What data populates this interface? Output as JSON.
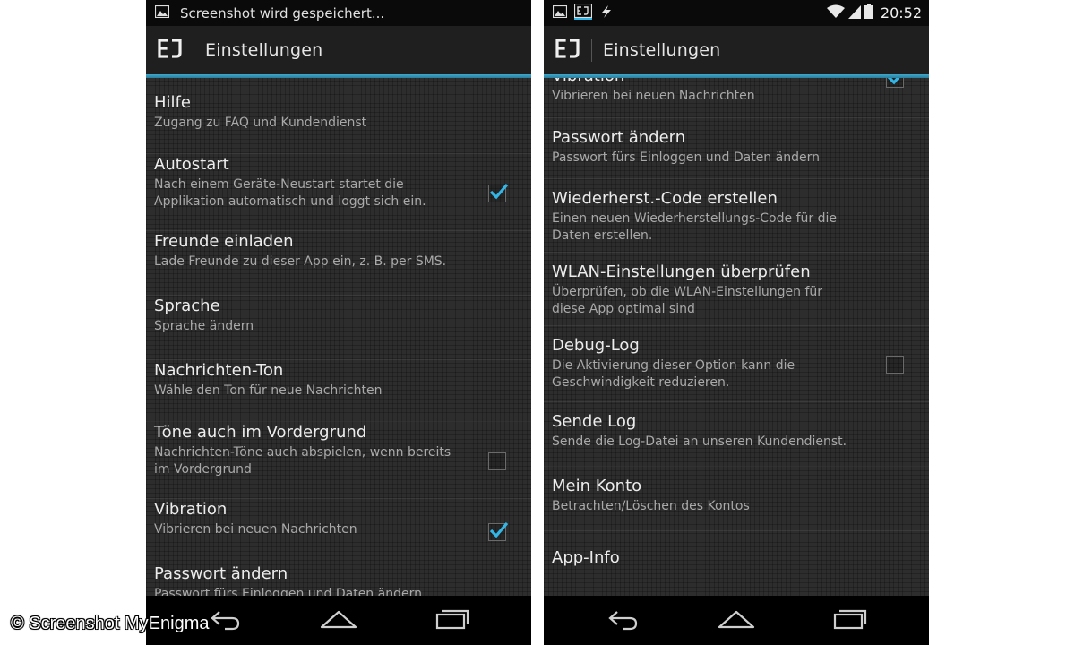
{
  "left_screen": {
    "status_text": "Screenshot wird gespeichert...",
    "title": "Einstellungen",
    "items": [
      {
        "title": "Hilfe",
        "summary": "Zugang zu FAQ und Kundendienst"
      },
      {
        "title": "Autostart",
        "summary": "Nach einem Geräte-Neustart startet die Applikation automatisch und loggt sich ein.",
        "checked": true
      },
      {
        "title": "Freunde einladen",
        "summary": "Lade Freunde zu dieser App ein, z. B. per SMS."
      },
      {
        "title": "Sprache",
        "summary": "Sprache ändern"
      },
      {
        "title": "Nachrichten-Ton",
        "summary": "Wähle den Ton für neue Nachrichten"
      },
      {
        "title": "Töne auch im Vordergrund",
        "summary": "Nachrichten-Töne auch abspielen, wenn bereits im Vordergrund",
        "checked": false
      },
      {
        "title": "Vibration",
        "summary": "Vibrieren bei neuen Nachrichten",
        "checked": true
      },
      {
        "title": "Passwort ändern",
        "summary": "Passwort fürs Einloggen und Daten ändern"
      }
    ]
  },
  "right_screen": {
    "time": "20:52",
    "title": "Einstellungen",
    "items": [
      {
        "title": "Vibration",
        "summary": "Vibrieren bei neuen Nachrichten",
        "checked": true
      },
      {
        "title": "Passwort ändern",
        "summary": "Passwort fürs Einloggen und Daten ändern"
      },
      {
        "title": "Wiederherst.-Code erstellen",
        "summary": "Einen neuen Wiederherstellungs-Code für die Daten erstellen."
      },
      {
        "title": "WLAN-Einstellungen überprüfen",
        "summary": "Überprüfen, ob die WLAN-Einstellungen für diese App optimal sind"
      },
      {
        "title": "Debug-Log",
        "summary": "Die Aktivierung dieser Option kann die Geschwindigkeit reduzieren.",
        "checked": false
      },
      {
        "title": "Sende Log",
        "summary": "Sende die Log-Datei an unseren Kundendienst."
      },
      {
        "title": "Mein Konto",
        "summary": "Betrachten/Löschen des Kontos"
      },
      {
        "title": "App-Info",
        "summary": ""
      }
    ]
  },
  "watermark": "© Screenshot MyEnigma",
  "colors": {
    "accent": "#33b5e5",
    "background": "#2d2d2d",
    "actionbar": "#1f1f1f",
    "statusbar": "#0a0a0a"
  },
  "icons": [
    "image-icon",
    "app-notification-icon",
    "flash-icon",
    "wifi-icon",
    "signal-icon",
    "battery-icon",
    "back-icon",
    "home-icon",
    "recents-icon",
    "check-icon"
  ]
}
